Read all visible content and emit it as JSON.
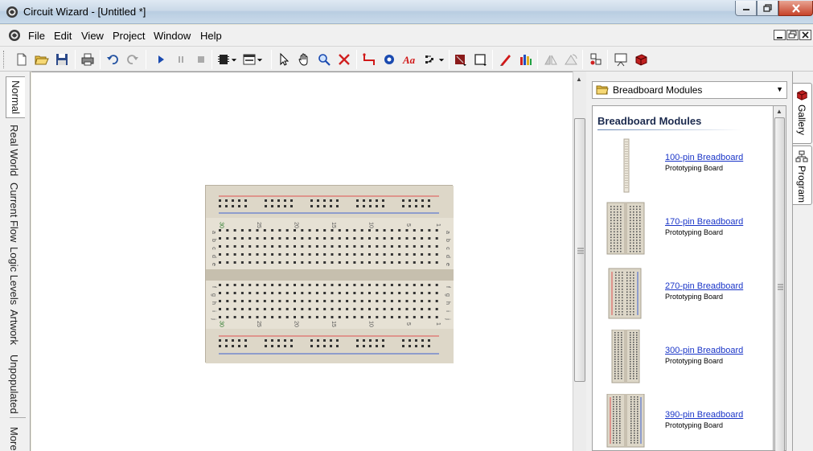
{
  "window": {
    "title": "Circuit Wizard - [Untitled *]"
  },
  "menu": {
    "items": [
      "File",
      "Edit",
      "View",
      "Project",
      "Window",
      "Help"
    ]
  },
  "left_tabs": [
    "Normal",
    "Real World",
    "Current Flow",
    "Logic Levels",
    "Artwork",
    "Unpopulated",
    "More"
  ],
  "breadboard": {
    "column_labels": [
      "30",
      "25",
      "20",
      "15",
      "10",
      "5",
      "1"
    ],
    "row_labels_top": [
      "a",
      "b",
      "c",
      "d",
      "e"
    ],
    "row_labels_bottom": [
      "f",
      "g",
      "h",
      "i",
      "j"
    ]
  },
  "gallery": {
    "selected": "Breadboard Modules",
    "heading": "Breadboard Modules",
    "items": [
      {
        "name": "100-pin Breadboard",
        "desc": "Prototyping Board"
      },
      {
        "name": "170-pin Breadboard",
        "desc": "Prototyping Board"
      },
      {
        "name": "270-pin Breadboard",
        "desc": "Prototyping Board"
      },
      {
        "name": "300-pin Breadboard",
        "desc": "Prototyping Board"
      },
      {
        "name": "390-pin Breadboard",
        "desc": "Prototyping Board"
      }
    ]
  },
  "right_tabs": [
    "Gallery",
    "Program"
  ],
  "colors": {
    "link": "#1a35c8",
    "breadboard": "#d8d2c2",
    "rail_red": "#e05050",
    "rail_blue": "#4060d0"
  }
}
